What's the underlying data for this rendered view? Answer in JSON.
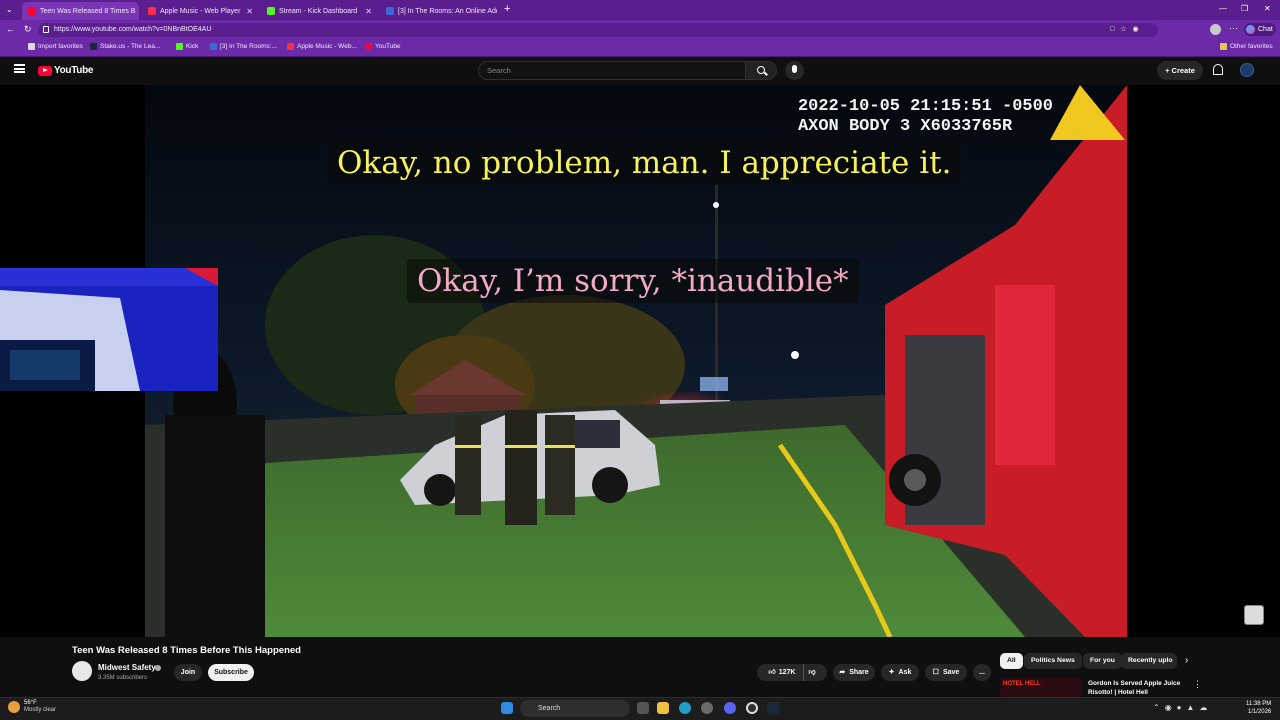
{
  "browser": {
    "tabs": [
      {
        "label": "Teen Was Released 8 Times B",
        "active": true,
        "color": "#ff0033"
      },
      {
        "label": "Apple Music - Web Player",
        "active": false,
        "color": "#fa2d48"
      },
      {
        "label": "Stream - Kick Dashboard",
        "active": false,
        "color": "#53fc18"
      },
      {
        "label": "[3] In The Rooms: An Online Addic",
        "active": false,
        "color": "#3a6ad8"
      }
    ],
    "new_tab": "+",
    "url": "https://www.youtube.com/watch?v=0NBnBtOE4AU",
    "chat_label": "Chat",
    "bookmarks": [
      {
        "label": "Import favorites",
        "color": "#d8d8d8"
      },
      {
        "label": "Stake.us - The Lea...",
        "color": "#1b2a3a"
      },
      {
        "label": "Kick",
        "color": "#53fc18"
      },
      {
        "label": "[3] In The Rooms:...",
        "color": "#3a6ad8"
      },
      {
        "label": "Apple Music - Web...",
        "color": "#fa2d48"
      },
      {
        "label": "YouTube",
        "color": "#ff0033"
      }
    ],
    "other_favorites": "Other favorites"
  },
  "youtube": {
    "logo": "YouTube",
    "search_placeholder": "Search",
    "create_label": "Create",
    "video": {
      "timestamp_line1": "2022-10-05 21:15:51 -0500",
      "timestamp_line2": "AXON BODY 3 X6033765R",
      "subtitle_1": "Okay, no problem, man. I appreciate it.",
      "subtitle_2": "Okay, I’m sorry, *inaudible*"
    },
    "title": "Teen Was Released 8 Times Before This Happened",
    "channel": "Midwest Safety",
    "subscribers": "3.35M subscribers",
    "join_label": "Join",
    "subscribe_label": "Subscribe",
    "like_count": "127K",
    "share_label": "Share",
    "ask_label": "Ask",
    "save_label": "Save",
    "more_label": "...",
    "chips": [
      "All",
      "Politics News",
      "For you",
      "Recently uplo"
    ],
    "rec_title_line1": "Gordon Is Served Apple Juice",
    "rec_title_line2": "Risotto! | Hotel Hell",
    "rec_thumb_text": "HOTEL HELL"
  },
  "taskbar": {
    "weather_temp": "56°F",
    "weather_desc": "Mostly clear",
    "search_label": "Search",
    "time": "11:38 PM",
    "date": "1/1/2026"
  },
  "colors": {
    "tab_strip": "#5a1e8f",
    "toolbar": "#6c2aa8",
    "subtitle_1_color": "#f5f25a",
    "subtitle_2_color": "#f4a8c8",
    "youtube_red": "#ff0033"
  }
}
